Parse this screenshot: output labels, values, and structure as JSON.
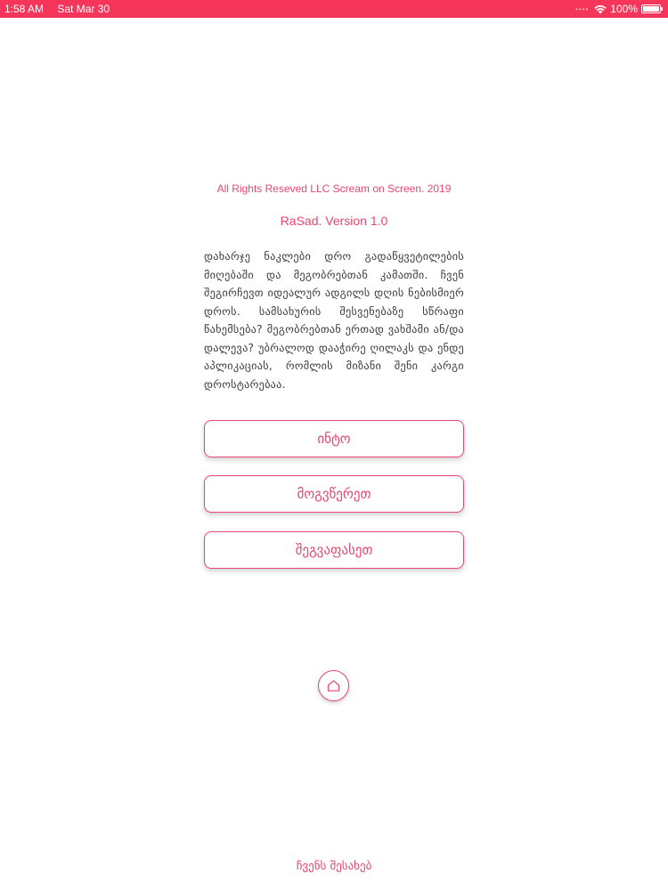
{
  "status_bar": {
    "time": "1:58 AM",
    "date": "Sat Mar 30",
    "battery_percent": "100%",
    "battery_level": 1.0,
    "wifi_icon": "wifi-icon",
    "battery_icon": "battery-icon",
    "background_color": "#f6355a"
  },
  "accent_color": "#e9466d",
  "copyright": "All Rights Reseved LLC Scream on Screen. 2019",
  "version": "RaSad. Version 1.0",
  "description": "დახარჯე ნაკლები დრო გადაწყვეტილების მიღებაში და მეგობრებთან კამათში. ჩვენ შეგირჩევთ იდეალურ ადგილს დღის ნებისმიერ დროს. სამსახურის შესვენებაზე სწრაფი წახემსება? მეგობრებთან ერთად ვახშამი ან/და დალევა? უბრალოდ დააჭირე ღილაკს და ენდე აპლიკაციას, რომლის მიზანი შენი კარგი დროსტარებაა.",
  "buttons": {
    "intro": "ინტო",
    "write_us": "მოგვწერეთ",
    "rate_us": "შეგვაფასეთ"
  },
  "home_button": {
    "icon": "home-icon"
  },
  "about_link": "ჩვენს შესახებ"
}
